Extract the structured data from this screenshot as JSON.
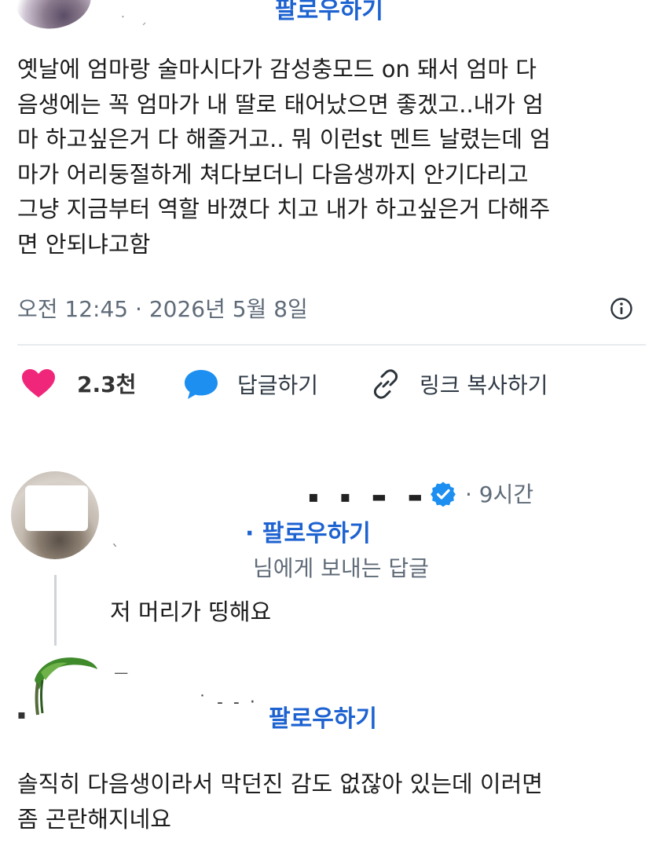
{
  "top": {
    "follow_label": "팔로우하기",
    "dots": "ㆍ ˏ"
  },
  "tweet": {
    "lines": [
      "옛날에 엄마랑 술마시다가 감성충모드 on 돼서 엄마 다",
      "음생에는 꼭 엄마가 내 딸로 태어났으면 좋겠고..내가 엄",
      "마 하고싶은거 다 해줄거고.. 뭐 이런st 멘트 날렸는데 엄",
      "마가 어리둥절하게 쳐다보더니 다음생까지 안기다리고",
      "그냥 지금부터 역할 바꼈다 치고 내가 하고싶은거 다해주",
      "면 안되냐고함"
    ],
    "timestamp": "오전 12:45 · 2026년 5월 8일"
  },
  "actions": {
    "like_count": "2.3천",
    "reply_label": "답글하기",
    "copy_link_label": "링크 복사하기"
  },
  "reply1": {
    "name_obscured": "▪ ▪ ▬ ▬",
    "time": "· 9시간",
    "follow_label": "· 팔로우하기",
    "replying_to": "님에게 보내는 답글",
    "text": "저 머리가 띵해요",
    "tick": "ˎ"
  },
  "reply2": {
    "small_mark": "ㅡ",
    "dash_dots": "˙ - - ·",
    "follow_label": "팔로우하기",
    "left_mark": "▪",
    "lines": [
      "솔직히 다음생이라서 막던진 감도 없잖아 있는데 이러면",
      "좀 곤란해지네요"
    ]
  },
  "colors": {
    "link_blue": "#1d62d1",
    "like_pink": "#f0267a",
    "reply_blue": "#1d8ff0",
    "meta_gray": "#5f6b78"
  },
  "icons": [
    "heart-icon",
    "speech-bubble-icon",
    "link-icon",
    "info-icon",
    "verified-badge-icon"
  ]
}
